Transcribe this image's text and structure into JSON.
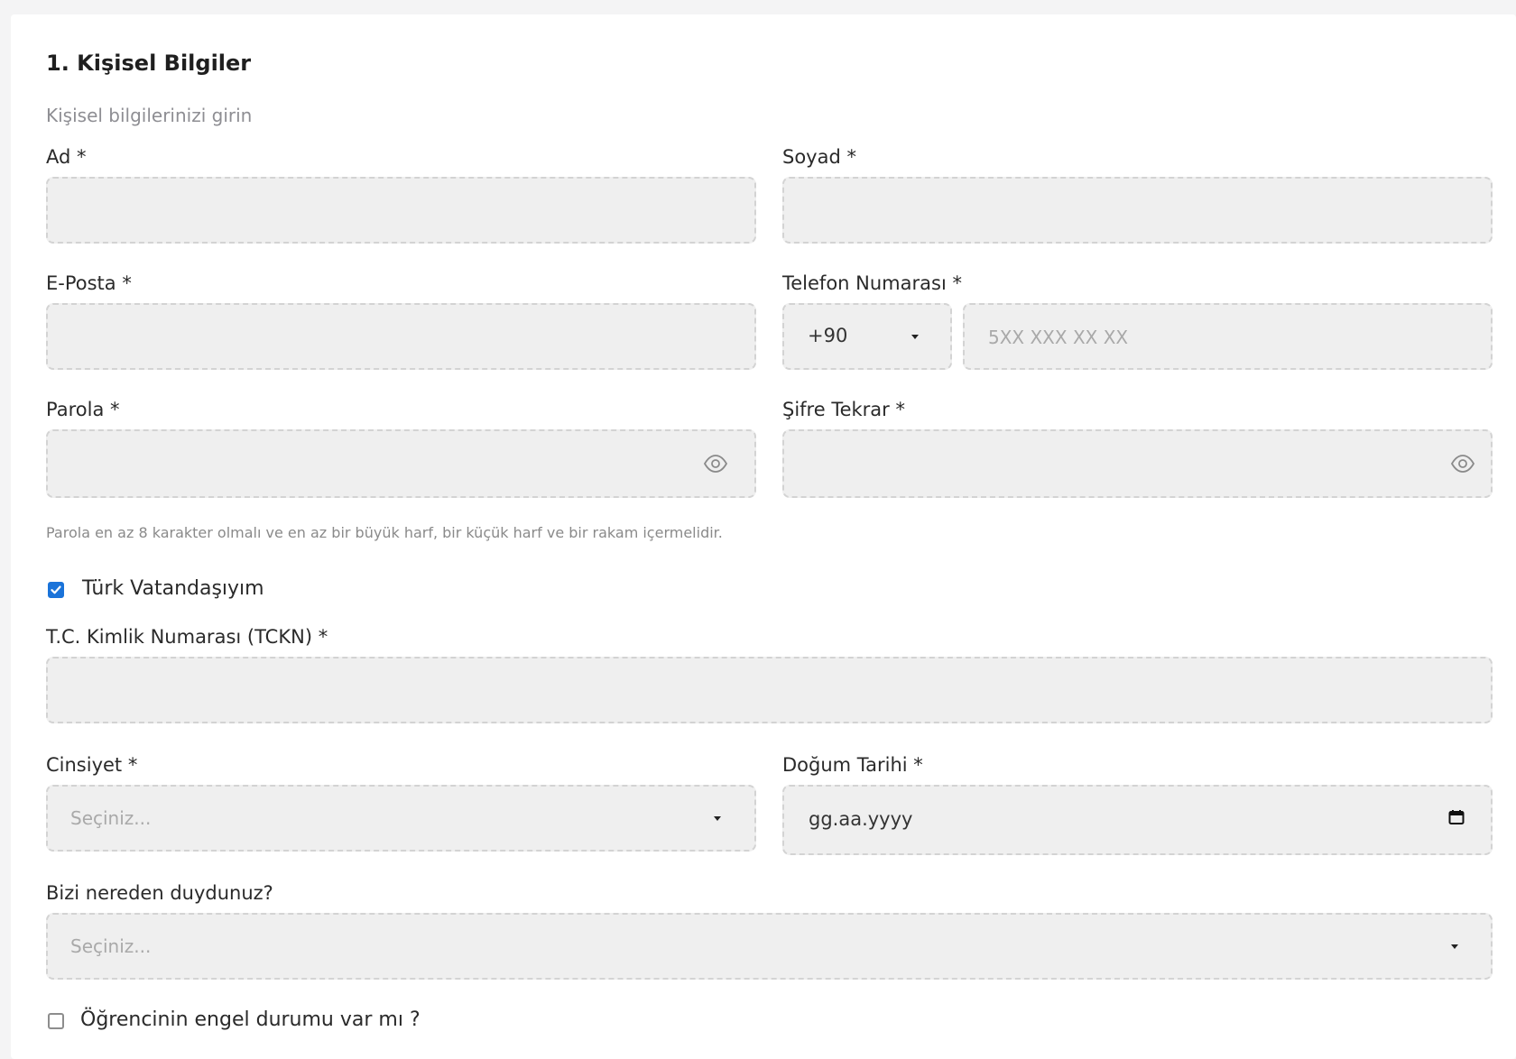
{
  "section": {
    "title": "1. Kişisel Bilgiler",
    "subtitle": "Kişisel bilgilerinizi girin"
  },
  "fields": {
    "first_name": {
      "label": "Ad *",
      "value": ""
    },
    "last_name": {
      "label": "Soyad *",
      "value": ""
    },
    "email": {
      "label": "E-Posta *",
      "value": ""
    },
    "phone": {
      "label": "Telefon Numarası *",
      "country_code": "+90",
      "placeholder": "5XX XXX XX XX",
      "value": ""
    },
    "password": {
      "label": "Parola *",
      "hint": "Parola en az 8 karakter olmalı ve en az bir büyük harf, bir küçük harf ve bir rakam içermelidir."
    },
    "password_repeat": {
      "label": "Şifre Tekrar *"
    },
    "citizen": {
      "label": "Türk Vatandaşıyım",
      "checked": true
    },
    "tckn": {
      "label": "T.C. Kimlik Numarası (TCKN) *",
      "value": ""
    },
    "gender": {
      "label": "Cinsiyet *",
      "selected": "Seçiniz..."
    },
    "birth_date": {
      "label": "Doğum Tarihi *",
      "placeholder": "gg.aa.yyyy"
    },
    "referral": {
      "label": "Bizi nereden duydunuz?",
      "selected": "Seçiniz..."
    },
    "disability": {
      "label": "Öğrencinin engel durumu var mı ?",
      "checked": false
    }
  },
  "icons": {
    "eye": "eye-icon",
    "caret": "chevron-down-icon",
    "calendar": "calendar-icon",
    "check": "check-icon"
  },
  "colors": {
    "accent": "#1a73d9",
    "field_bg": "#efefef",
    "field_border": "#d3d3d3"
  }
}
